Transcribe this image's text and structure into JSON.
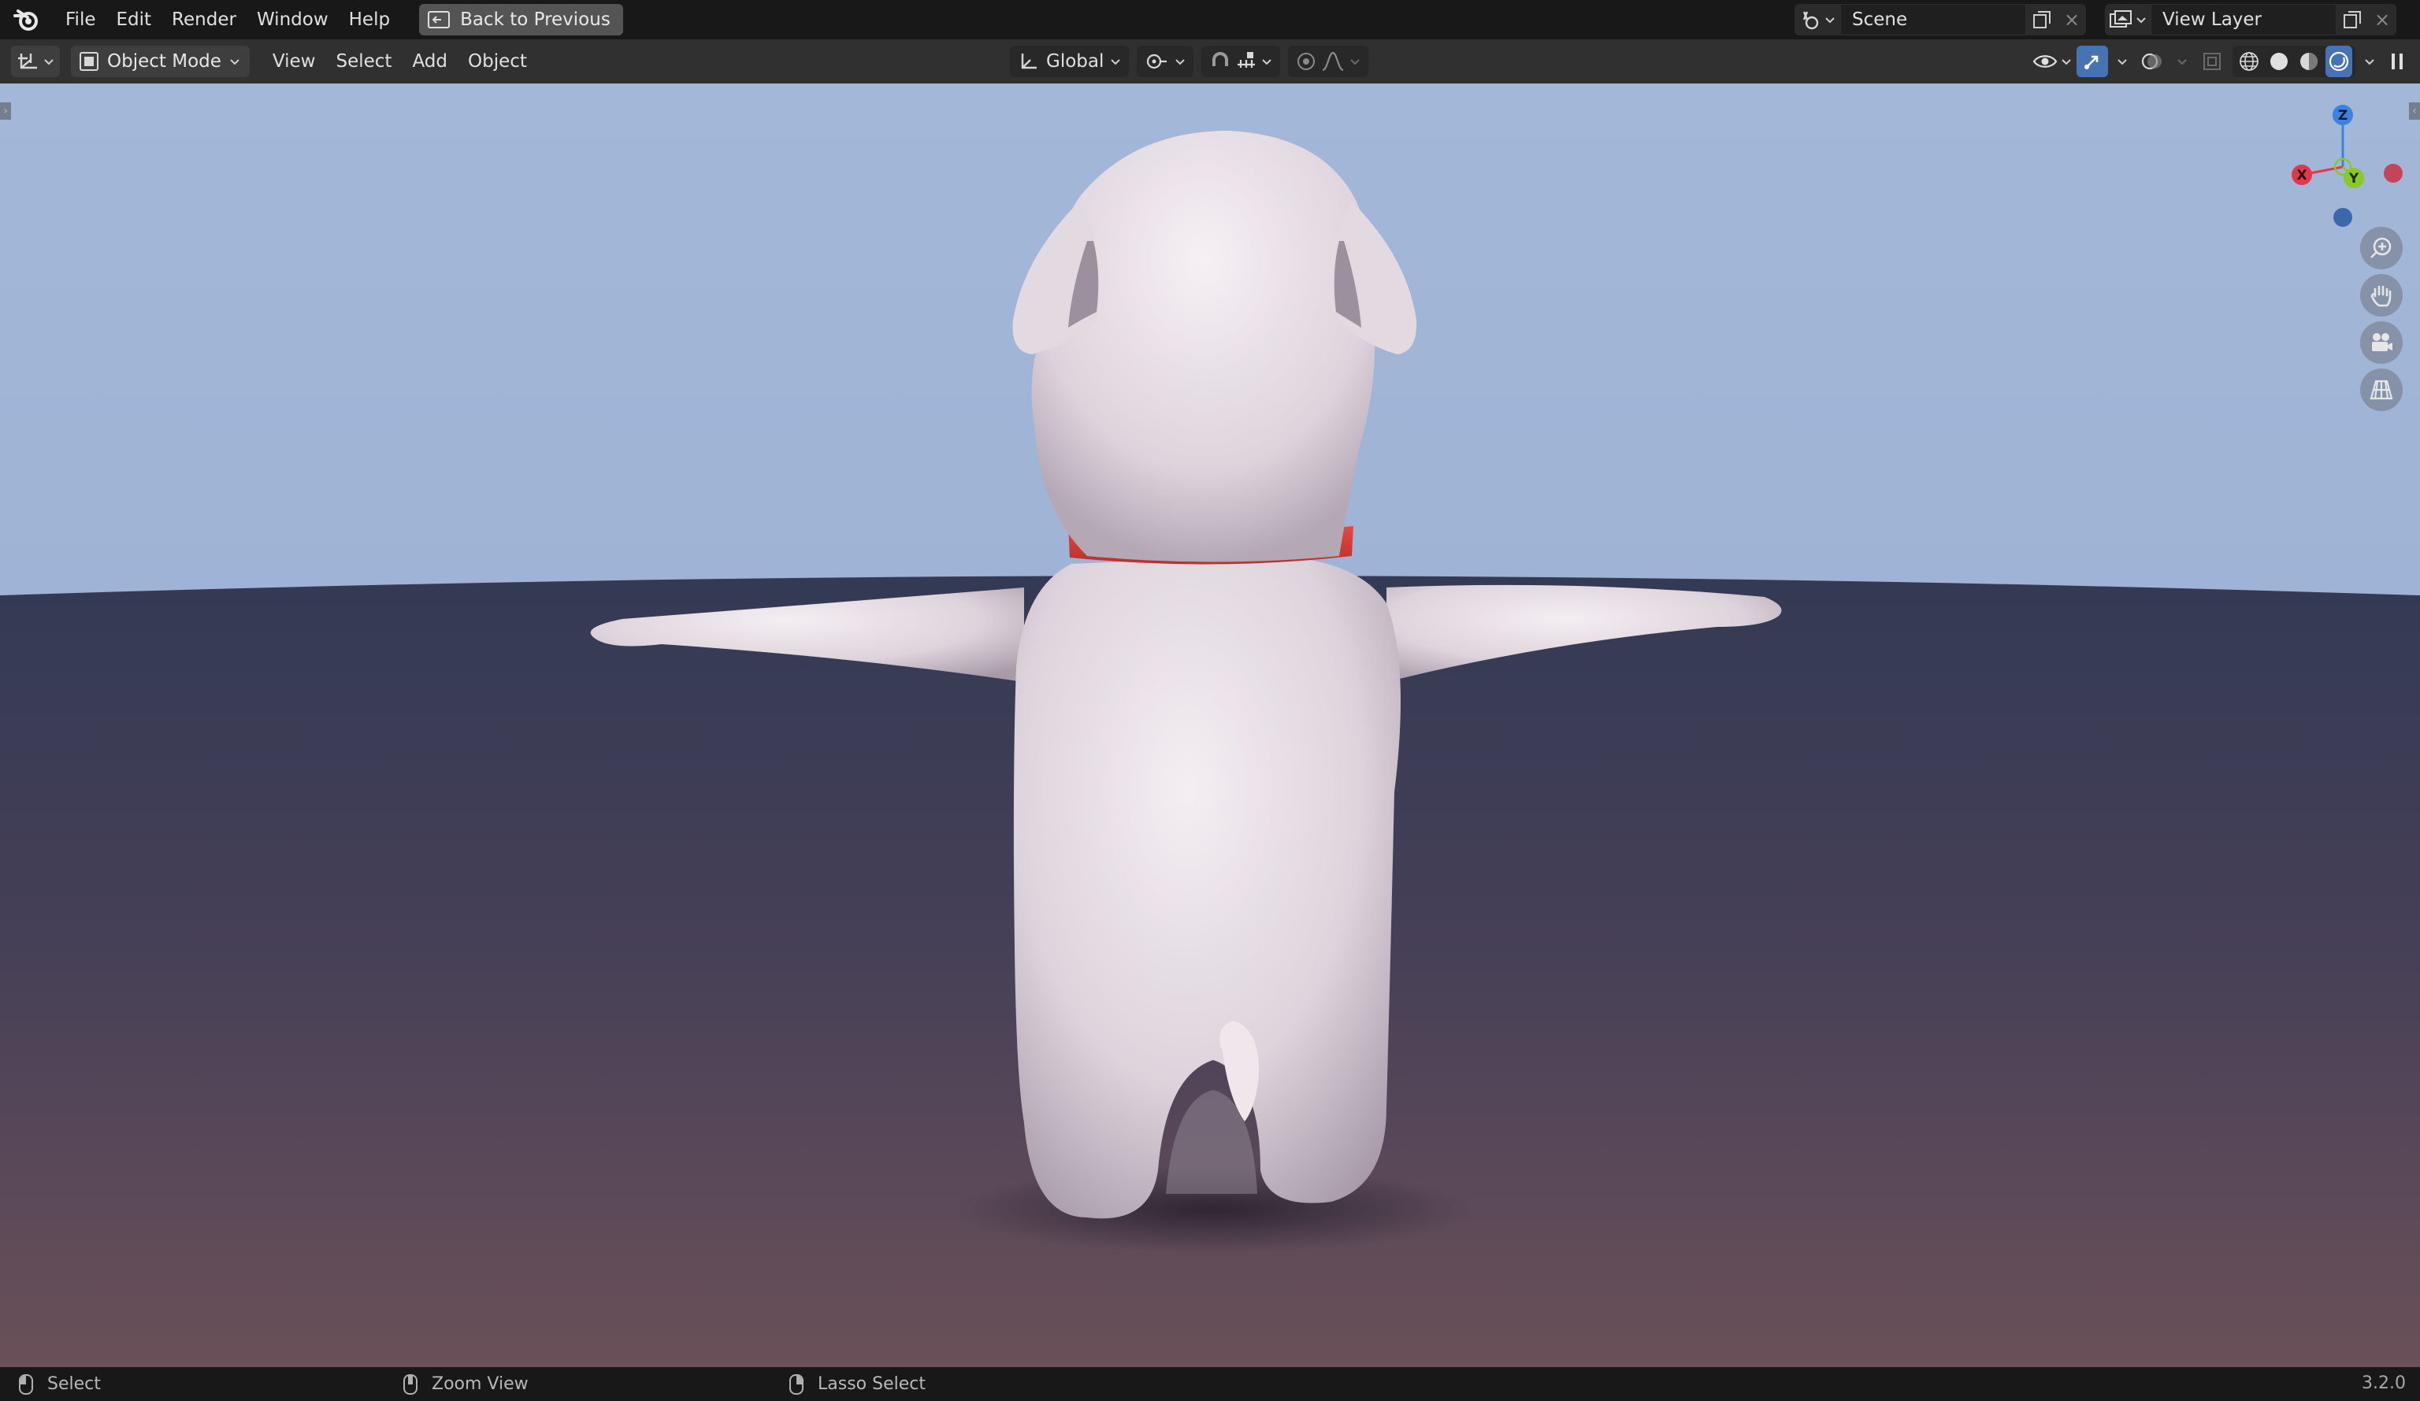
{
  "menu": {
    "items": [
      "File",
      "Edit",
      "Render",
      "Window",
      "Help"
    ],
    "back_label": "Back to Previous"
  },
  "workspace": {
    "scene_name": "Scene",
    "view_layer_name": "View Layer"
  },
  "header": {
    "mode": "Object Mode",
    "menus": [
      "View",
      "Select",
      "Add",
      "Object"
    ],
    "transform_orientation": "Global"
  },
  "gizmo": {
    "x_label": "X",
    "y_label": "Y",
    "z_label": "Z",
    "colors": {
      "x": "#e0394c",
      "y": "#8ac926",
      "z": "#3d82e0"
    }
  },
  "viewport": {
    "shading": "rendered",
    "collar_color": "#d63a35",
    "floor_color": "#3a3f55"
  },
  "status": {
    "left_click": "Select",
    "middle_click": "Zoom View",
    "right_click": "Lasso Select",
    "version": "3.2.0"
  }
}
